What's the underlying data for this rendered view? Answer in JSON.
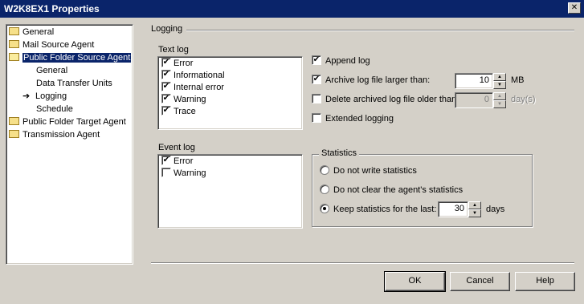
{
  "window": {
    "title": "W2K8EX1 Properties",
    "close_glyph": "✕"
  },
  "tree": {
    "items": [
      {
        "label": "General",
        "icon": "folder-icon"
      },
      {
        "label": "Mail Source Agent",
        "icon": "folder-icon"
      },
      {
        "label": "Public Folder Source Agent",
        "icon": "open-folder-icon",
        "selected": true
      },
      {
        "label": "General"
      },
      {
        "label": "Data Transfer Units"
      },
      {
        "label": "Logging",
        "icon": "arrow-icon"
      },
      {
        "label": "Schedule"
      },
      {
        "label": "Public Folder Target Agent",
        "icon": "folder-icon"
      },
      {
        "label": "Transmission Agent",
        "icon": "folder-icon"
      }
    ],
    "arrow_glyph": "➔"
  },
  "logging": {
    "section_label": "Logging",
    "text_log": {
      "label": "Text log",
      "items": [
        {
          "label": "Error",
          "checked": true
        },
        {
          "label": "Informational",
          "checked": true
        },
        {
          "label": "Internal error",
          "checked": true
        },
        {
          "label": "Warning",
          "checked": true
        },
        {
          "label": "Trace",
          "checked": true
        }
      ]
    },
    "event_log": {
      "label": "Event log",
      "items": [
        {
          "label": "Error",
          "checked": true
        },
        {
          "label": "Warning",
          "checked": false
        }
      ]
    },
    "options": {
      "append_log": {
        "label": "Append log",
        "checked": true
      },
      "archive_log": {
        "label": "Archive log file larger than:",
        "checked": true,
        "value": "10",
        "unit": "MB"
      },
      "delete_archived": {
        "label": "Delete archived log file older than",
        "checked": false,
        "value": "0",
        "unit": "day(s)"
      },
      "extended_logging": {
        "label": "Extended logging",
        "checked": false
      }
    },
    "statistics": {
      "label": "Statistics",
      "options": [
        {
          "label": "Do not write statistics",
          "selected": false
        },
        {
          "label": "Do not clear the agent's statistics",
          "selected": false
        },
        {
          "label": "Keep statistics for the last:",
          "selected": true
        }
      ],
      "days_value": "30",
      "days_unit": "days"
    }
  },
  "buttons": {
    "ok": "OK",
    "cancel": "Cancel",
    "help": "Help"
  },
  "glyphs": {
    "check": "✔",
    "spin_up": "▲",
    "spin_down": "▼"
  }
}
